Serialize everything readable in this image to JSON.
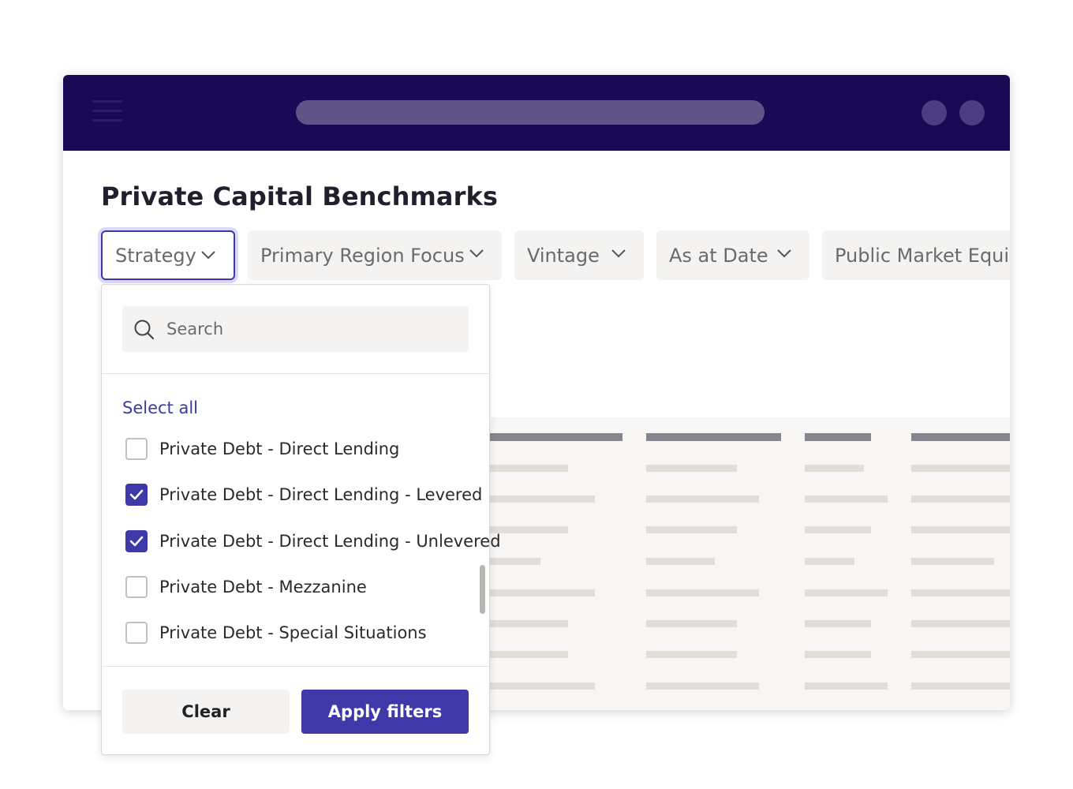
{
  "page": {
    "title": "Private Capital Benchmarks"
  },
  "filters": [
    {
      "label": "Strategy",
      "active": true
    },
    {
      "label": "Primary Region Focus",
      "active": false
    },
    {
      "label": "Vintage",
      "active": false
    },
    {
      "label": "As at Date",
      "active": false
    },
    {
      "label": "Public Market Equiva",
      "active": false
    }
  ],
  "dropdown": {
    "search_placeholder": "Search",
    "select_all_label": "Select all",
    "options": [
      {
        "label": "Private Debt - Direct Lending",
        "checked": false
      },
      {
        "label": "Private Debt - Direct Lending - Levered",
        "checked": true
      },
      {
        "label": "Private Debt - Direct Lending - Unlevered",
        "checked": true
      },
      {
        "label": "Private Debt - Mezzanine",
        "checked": false
      },
      {
        "label": "Private Debt - Special Situations",
        "checked": false
      }
    ],
    "clear_label": "Clear",
    "apply_label": "Apply filters"
  },
  "colors": {
    "titlebar": "#1a0a56",
    "accent": "#3e38a8",
    "focus_ring": "#dcdaf7",
    "filter_bg": "#f4f3f1",
    "table_bg": "#f7f6f4"
  },
  "icons": {
    "menu": "hamburger-icon",
    "search": "search-icon",
    "chevron": "chevron-down-icon",
    "check": "checkmark-icon"
  }
}
